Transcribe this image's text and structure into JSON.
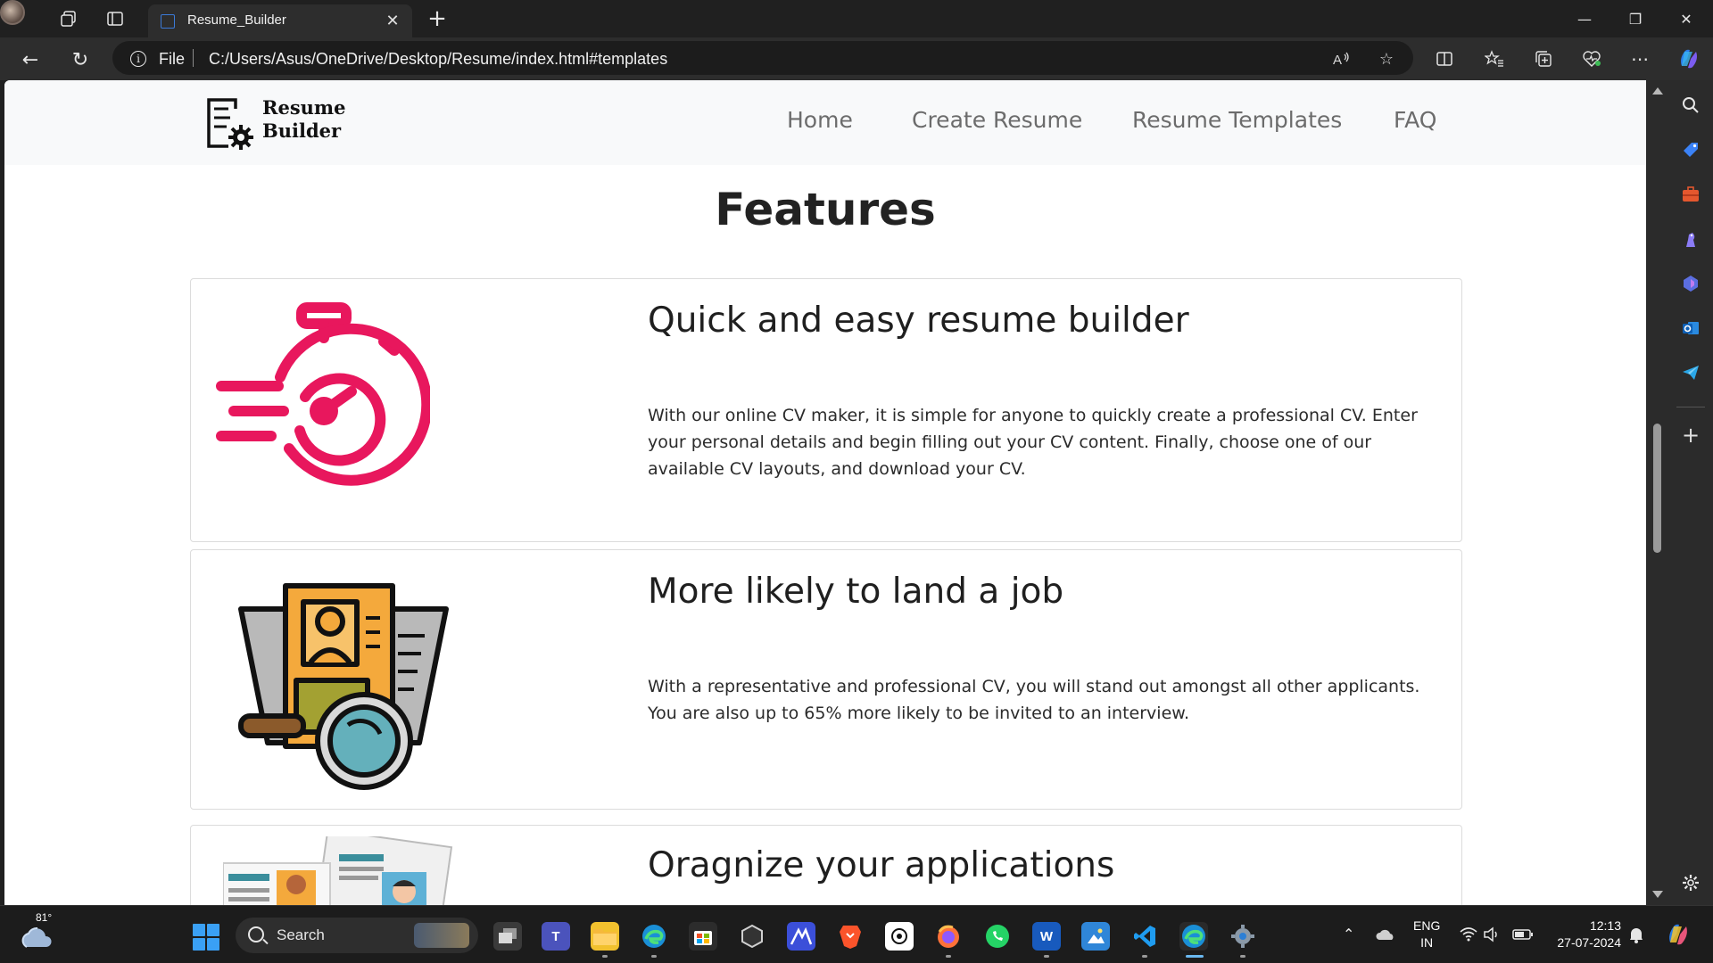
{
  "browser": {
    "tab_title": "Resume_Builder",
    "close_tab_glyph": "✕",
    "new_tab_glyph": "+",
    "window_controls": {
      "minimize": "—",
      "restore": "❐",
      "close": "✕"
    },
    "nav": {
      "back": "←",
      "refresh": "↻"
    },
    "address": {
      "scheme_label": "File",
      "url": "C:/Users/Asus/OneDrive/Desktop/Resume/index.html#templates"
    }
  },
  "site": {
    "logo_text_line1": "Resume",
    "logo_text_line2": "Builder",
    "menu": [
      {
        "label": "Home"
      },
      {
        "label": "Create Resume"
      },
      {
        "label": "Resume Templates"
      },
      {
        "label": "FAQ"
      }
    ],
    "features_title": "Features",
    "features": [
      {
        "heading": "Quick and easy resume builder",
        "text": "With our online CV maker, it is simple for anyone to quickly create a professional CV. Enter your personal details and begin filling out your CV content. Finally, choose one of our available CV layouts, and download your CV.",
        "icon": "stopwatch-icon"
      },
      {
        "heading": "More likely to land a job",
        "text": "With a representative and professional CV, you will stand out amongst all other applicants. You are also up to 65% more likely to be invited to an interview.",
        "icon": "resume-search-icon"
      },
      {
        "heading": "Oragnize your applications",
        "text": "",
        "icon": "applications-icon"
      }
    ],
    "accent_color": "#e8175d"
  },
  "taskbar": {
    "weather_temp": "81°",
    "search_label": "Search",
    "lang_line1": "ENG",
    "lang_line2": "IN",
    "time": "12:13",
    "date": "27-07-2024"
  }
}
